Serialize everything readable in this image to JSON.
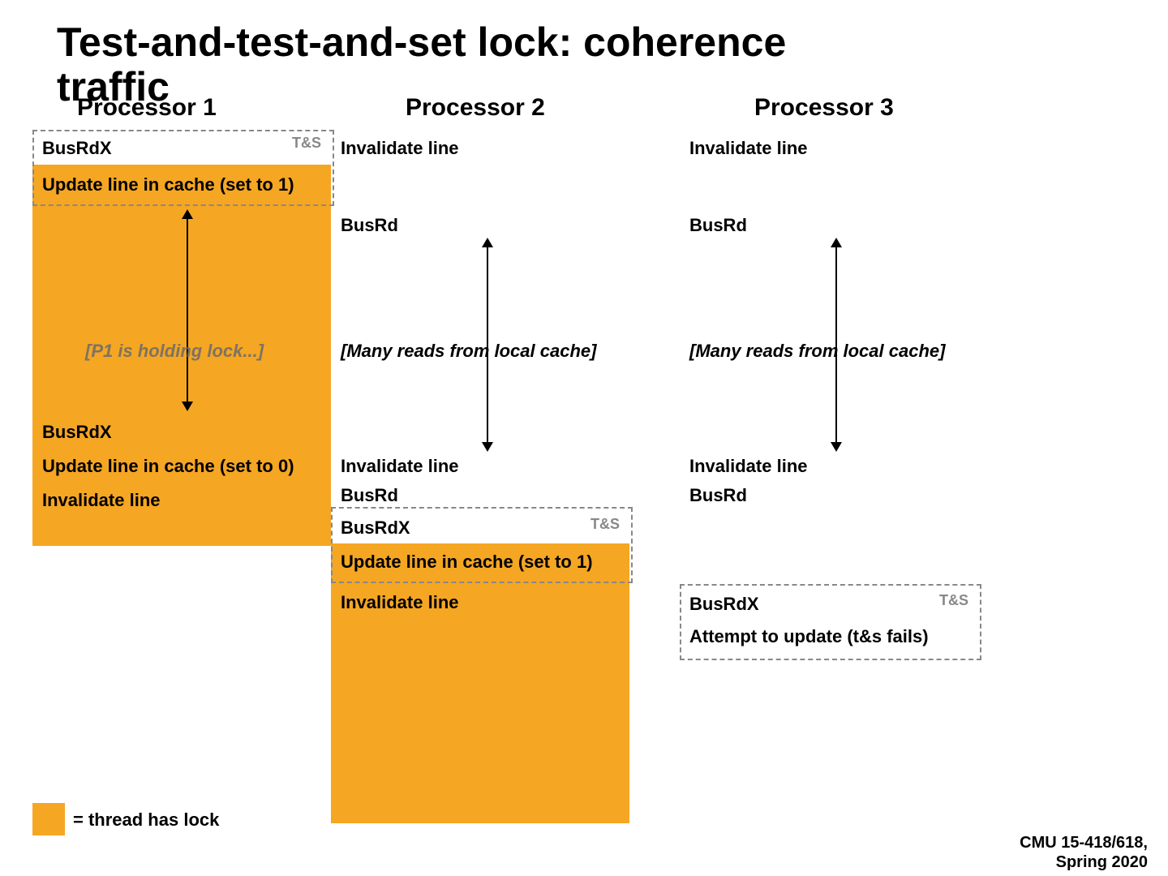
{
  "title": "Test-and-test-and-set lock: coherence traffic",
  "columns": {
    "p1": {
      "header": "Processor 1"
    },
    "p2": {
      "header": "Processor 2"
    },
    "p3": {
      "header": "Processor 3"
    }
  },
  "labels": {
    "ts": "T&S"
  },
  "events": {
    "p1": {
      "busrdx1": "BusRdX",
      "update1": "Update line in cache (set to 1)",
      "hold": "[P1 is holding lock...]",
      "busrdx2": "BusRdX",
      "update0": "Update line in cache (set to 0)",
      "inval": "Invalidate line"
    },
    "p2": {
      "inval1": "Invalidate line",
      "busrd1": "BusRd",
      "reads": "[Many reads from local cache]",
      "inval2": "Invalidate line",
      "busrd2": "BusRd",
      "busrdx": "BusRdX",
      "update1": "Update line in cache (set to 1)",
      "inval3": "Invalidate line"
    },
    "p3": {
      "inval1": "Invalidate line",
      "busrd1": "BusRd",
      "reads": "[Many reads from local cache]",
      "inval2": "Invalidate line",
      "busrd2": "BusRd",
      "busrdx": "BusRdX",
      "fail": "Attempt to update (t&s fails)"
    }
  },
  "legend": "= thread has lock",
  "footer": {
    "course": "CMU 15-418/618,",
    "term": "Spring 2020"
  },
  "colors": {
    "accent": "#f5a623"
  }
}
